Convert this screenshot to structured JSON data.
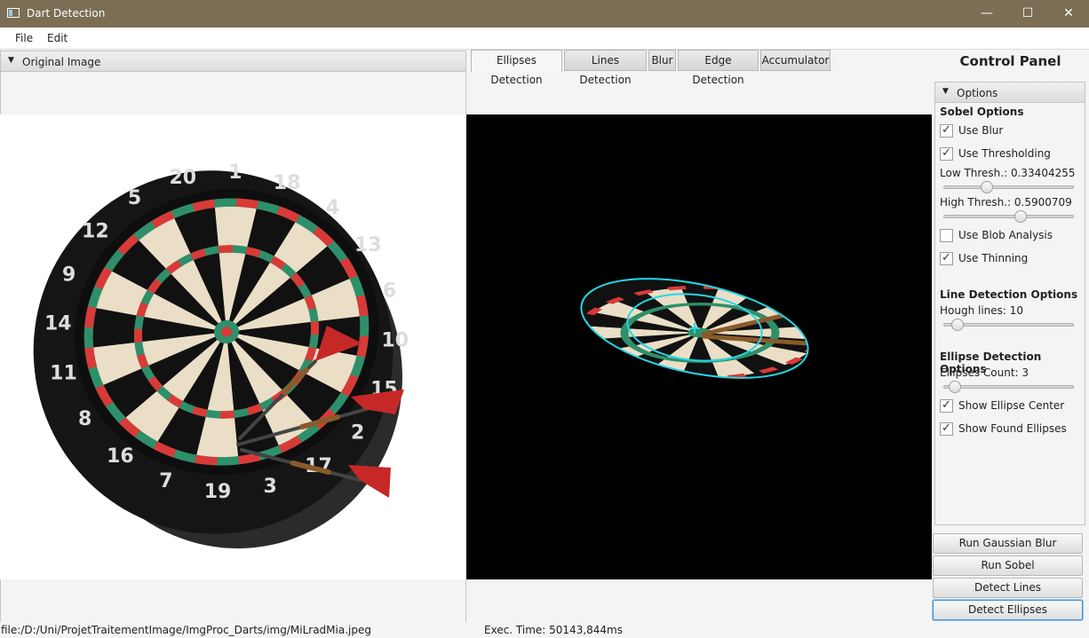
{
  "window": {
    "title": "Dart Detection",
    "minimize": "—",
    "maximize": "☐",
    "close": "✕"
  },
  "menu": [
    {
      "label": "File"
    },
    {
      "label": "Edit"
    }
  ],
  "left_panel": {
    "title": "Original Image"
  },
  "tabs": [
    {
      "label": "Ellipses Detection",
      "active": true
    },
    {
      "label": "Lines Detection",
      "active": false
    },
    {
      "label": "Blur",
      "active": false
    },
    {
      "label": "Edge Detection",
      "active": false
    },
    {
      "label": "Accumulator",
      "active": false
    }
  ],
  "board_numbers": [
    "20",
    "1",
    "18",
    "4",
    "13",
    "6",
    "10",
    "15",
    "2",
    "17",
    "3",
    "19",
    "7",
    "16",
    "8",
    "11",
    "14",
    "9",
    "12",
    "5"
  ],
  "control_panel": {
    "title": "Control Panel",
    "options_title": "Options",
    "sobel_title": "Sobel Options",
    "use_blur": {
      "label": "Use Blur",
      "checked": true
    },
    "use_thresholding": {
      "label": "Use Thresholding",
      "checked": true
    },
    "low_thresh": {
      "label": "Low Thresh.: 0.33404255",
      "value": 0.334
    },
    "high_thresh": {
      "label": "High Thresh.: 0.5900709",
      "value": 0.59
    },
    "use_blob": {
      "label": "Use Blob Analysis",
      "checked": false
    },
    "use_thinning": {
      "label": "Use Thinning",
      "checked": true
    },
    "line_title": "Line Detection Options",
    "hough_lines": {
      "label": "Hough lines: 10",
      "value": 0.1
    },
    "ellipse_title": "Ellipse Detection Options",
    "ellipses_count": {
      "label": "Ellipses Count: 3",
      "value": 0.08
    },
    "show_center": {
      "label": "Show Ellipse Center",
      "checked": true
    },
    "show_found": {
      "label": "Show Found Ellipses",
      "checked": true
    },
    "buttons": {
      "gaussian": "Run Gaussian Blur",
      "sobel": "Run Sobel",
      "lines": "Detect Lines",
      "ellipses": "Detect Ellipses"
    }
  },
  "status": {
    "path": "file:/D:/Uni/ProjetTraitementImage/ImgProc_Darts/img/MiLradMia.jpeg",
    "exec_time": "Exec. Time: 50143,844ms"
  },
  "colors": {
    "title_bar": "#7b6e54",
    "ellipse": "#25d6e6",
    "board_red": "#d83a38",
    "board_green": "#2f8f6a"
  }
}
